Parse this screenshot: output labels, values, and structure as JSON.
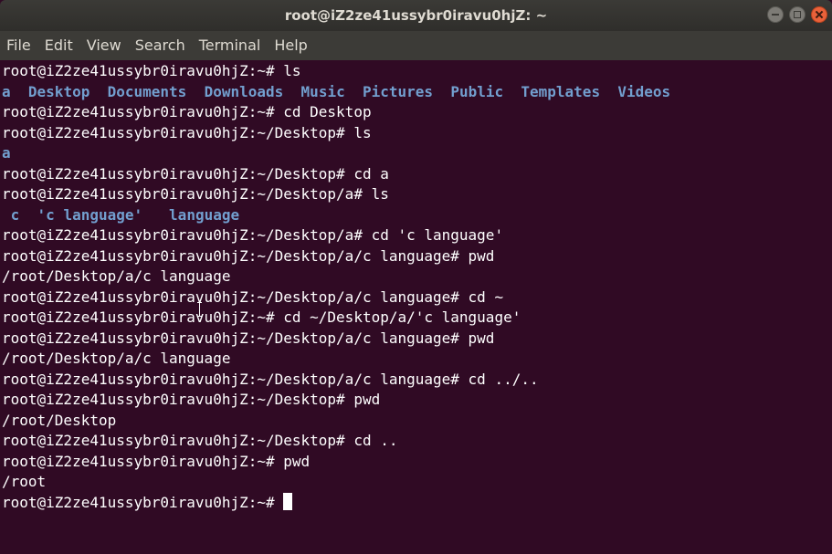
{
  "window": {
    "title": "root@iZ2ze41ussybr0iravu0hjZ: ~"
  },
  "menu": {
    "items": [
      "File",
      "Edit",
      "View",
      "Search",
      "Terminal",
      "Help"
    ]
  },
  "terminal": {
    "colors": {
      "background": "#300a24",
      "text": "#ffffff",
      "directory": "#729fcf"
    },
    "lines": [
      "root@iZ2ze41ussybr0iravu0hjZ:~# ls",
      "root@iZ2ze41ussybr0iravu0hjZ:~# cd Desktop",
      "root@iZ2ze41ussybr0iravu0hjZ:~/Desktop# ls",
      "root@iZ2ze41ussybr0iravu0hjZ:~/Desktop# cd a",
      "root@iZ2ze41ussybr0iravu0hjZ:~/Desktop/a# ls",
      "root@iZ2ze41ussybr0iravu0hjZ:~/Desktop/a# cd 'c language'",
      "root@iZ2ze41ussybr0iravu0hjZ:~/Desktop/a/c language# pwd",
      "/root/Desktop/a/c language",
      "root@iZ2ze41ussybr0iravu0hjZ:~/Desktop/a/c language# cd ~",
      "root@iZ2ze41ussybr0iravu0hjZ:~# cd ~/Desktop/a/'c language'",
      "root@iZ2ze41ussybr0iravu0hjZ:~/Desktop/a/c language# pwd",
      "/root/Desktop/a/c language",
      "root@iZ2ze41ussybr0iravu0hjZ:~/Desktop/a/c language# cd ../..",
      "root@iZ2ze41ussybr0iravu0hjZ:~/Desktop# pwd",
      "/root/Desktop",
      "root@iZ2ze41ussybr0iravu0hjZ:~/Desktop# cd ..",
      "root@iZ2ze41ussybr0iravu0hjZ:~# pwd",
      "/root",
      "root@iZ2ze41ussybr0iravu0hjZ:~# "
    ],
    "ls_home": [
      "a",
      "Desktop",
      "Documents",
      "Downloads",
      "Music",
      "Pictures",
      "Public",
      "Templates",
      "Videos"
    ],
    "ls_desktop": [
      "a"
    ],
    "ls_a": [
      "c",
      "'c language'",
      "language"
    ]
  }
}
